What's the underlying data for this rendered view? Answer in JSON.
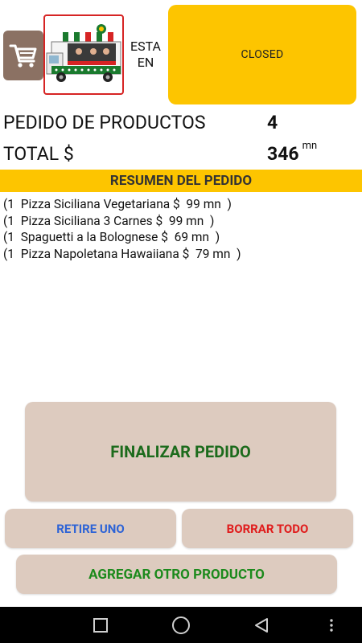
{
  "header": {
    "status_prefix": "ESTA EN",
    "status": "CLOSED"
  },
  "summary": {
    "pedido_label": "PEDIDO DE PRODUCTOS",
    "pedido_count": "4",
    "total_label": "TOTAL $",
    "total_value": "346",
    "total_unit": "mn"
  },
  "resumen": {
    "title": "RESUMEN DEL PEDIDO",
    "items": [
      "(1  Pizza Siciliana Vegetariana $  99 mn  )",
      "(1  Pizza Siciliana 3 Carnes $  99 mn  )",
      "(1  Spaguetti a la Bolognese $  69 mn  )",
      "(1  Pizza Napoletana Hawaiiana $  79 mn  )"
    ]
  },
  "buttons": {
    "finalizar": "FINALIZAR PEDIDO",
    "retire": "RETIRE UNO",
    "borrar": "BORRAR TODO",
    "agregar": "AGREGAR OTRO PRODUCTO"
  },
  "colors": {
    "accent_yellow": "#fdc500",
    "button_bg": "#ddcbbf",
    "cart_bg": "#8b7163",
    "green_text": "#1c6b1c",
    "blue_text": "#2d63d6",
    "red_text": "#e01c1c"
  },
  "icons": {
    "cart": "shopping-cart-icon",
    "logo": "food-truck-image",
    "nav_recent": "square-recents-icon",
    "nav_home": "circle-home-icon",
    "nav_back": "triangle-back-icon",
    "nav_menu": "dots-menu-icon"
  }
}
